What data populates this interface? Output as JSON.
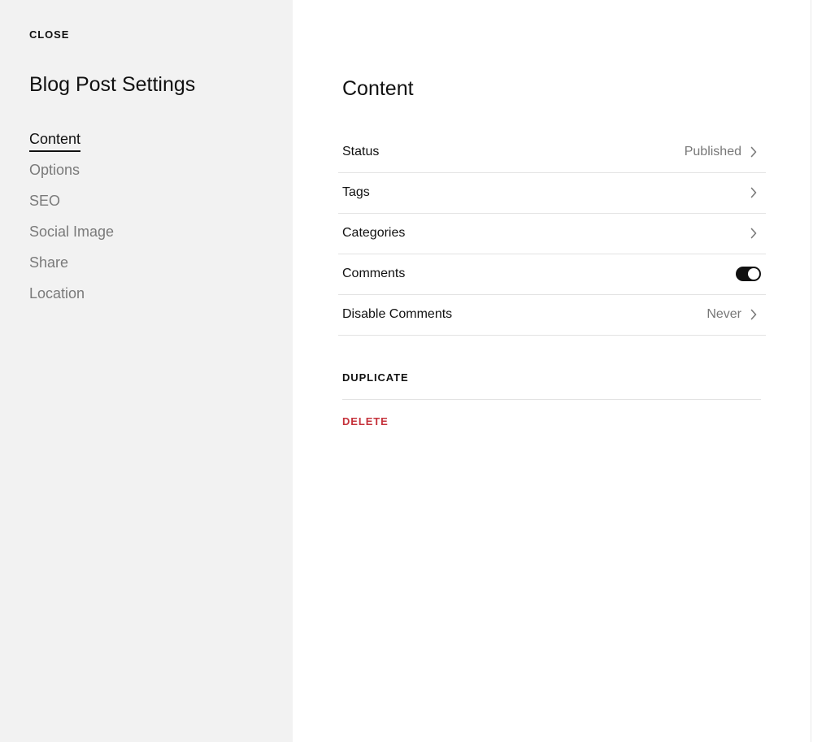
{
  "sidebar": {
    "close_label": "CLOSE",
    "title": "Blog Post Settings",
    "nav": [
      {
        "label": "Content",
        "active": true
      },
      {
        "label": "Options",
        "active": false
      },
      {
        "label": "SEO",
        "active": false
      },
      {
        "label": "Social Image",
        "active": false
      },
      {
        "label": "Share",
        "active": false
      },
      {
        "label": "Location",
        "active": false
      }
    ]
  },
  "main": {
    "title": "Content",
    "rows": [
      {
        "label": "Status",
        "value": "Published",
        "control": "chevron-right-icon"
      },
      {
        "label": "Tags",
        "value": "",
        "control": "chevron-right-icon"
      },
      {
        "label": "Categories",
        "value": "",
        "control": "chevron-right-icon"
      },
      {
        "label": "Comments",
        "value": "",
        "control": "toggle",
        "toggle_on": true
      },
      {
        "label": "Disable Comments",
        "value": "Never",
        "control": "chevron-right-icon"
      }
    ],
    "actions": {
      "duplicate_label": "DUPLICATE",
      "delete_label": "DELETE"
    }
  },
  "colors": {
    "sidebar_bg": "#f2f2f2",
    "text_primary": "#111111",
    "text_muted": "#7a7a7a",
    "divider": "#e3e3e3",
    "danger": "#c5323b",
    "toggle_on": "#111111"
  }
}
